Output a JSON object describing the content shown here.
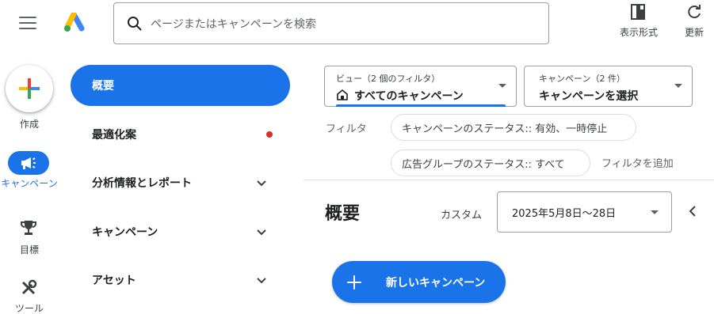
{
  "header": {
    "menu_icon": "hamburger-menu-icon",
    "logo_icon": "google-ads-logo",
    "search": {
      "placeholder": "ページまたはキャンペーンを検索",
      "icon": "search-icon"
    },
    "view_format_label": "表示形式",
    "refresh_label": "更新"
  },
  "rail": {
    "create_label": "作成",
    "campaigns_label": "キャンペーン",
    "goals_label": "目標",
    "tools_label": "ツール"
  },
  "nav": {
    "active": "概要",
    "items": [
      {
        "label": "最適化案",
        "badge": "red-dot"
      },
      {
        "label": "分析情報とレポート",
        "expandable": true
      },
      {
        "label": "キャンペーン",
        "expandable": true
      },
      {
        "label": "アセット",
        "expandable": true
      }
    ]
  },
  "filters": {
    "view": {
      "caption": "ビュー（2 個のフィルタ）",
      "value": "すべてのキャンペーン"
    },
    "campaign": {
      "caption": "キャンペーン（2 件）",
      "value": "キャンペーンを選択"
    },
    "filter_label": "フィルタ",
    "chips": [
      "キャンペーンのステータス:: 有効、一時停止",
      "広告グループのステータス:: すべて"
    ],
    "add_filter": "フィルタを追加"
  },
  "main": {
    "title": "概要",
    "date_mode": "カスタム",
    "date_range": "2025年5月8日〜28日",
    "new_campaign_button": "新しいキャンペーン"
  },
  "colors": {
    "accent": "#1a73e8",
    "badge_red": "#d93025",
    "text": "#202124",
    "muted": "#5f6368"
  }
}
